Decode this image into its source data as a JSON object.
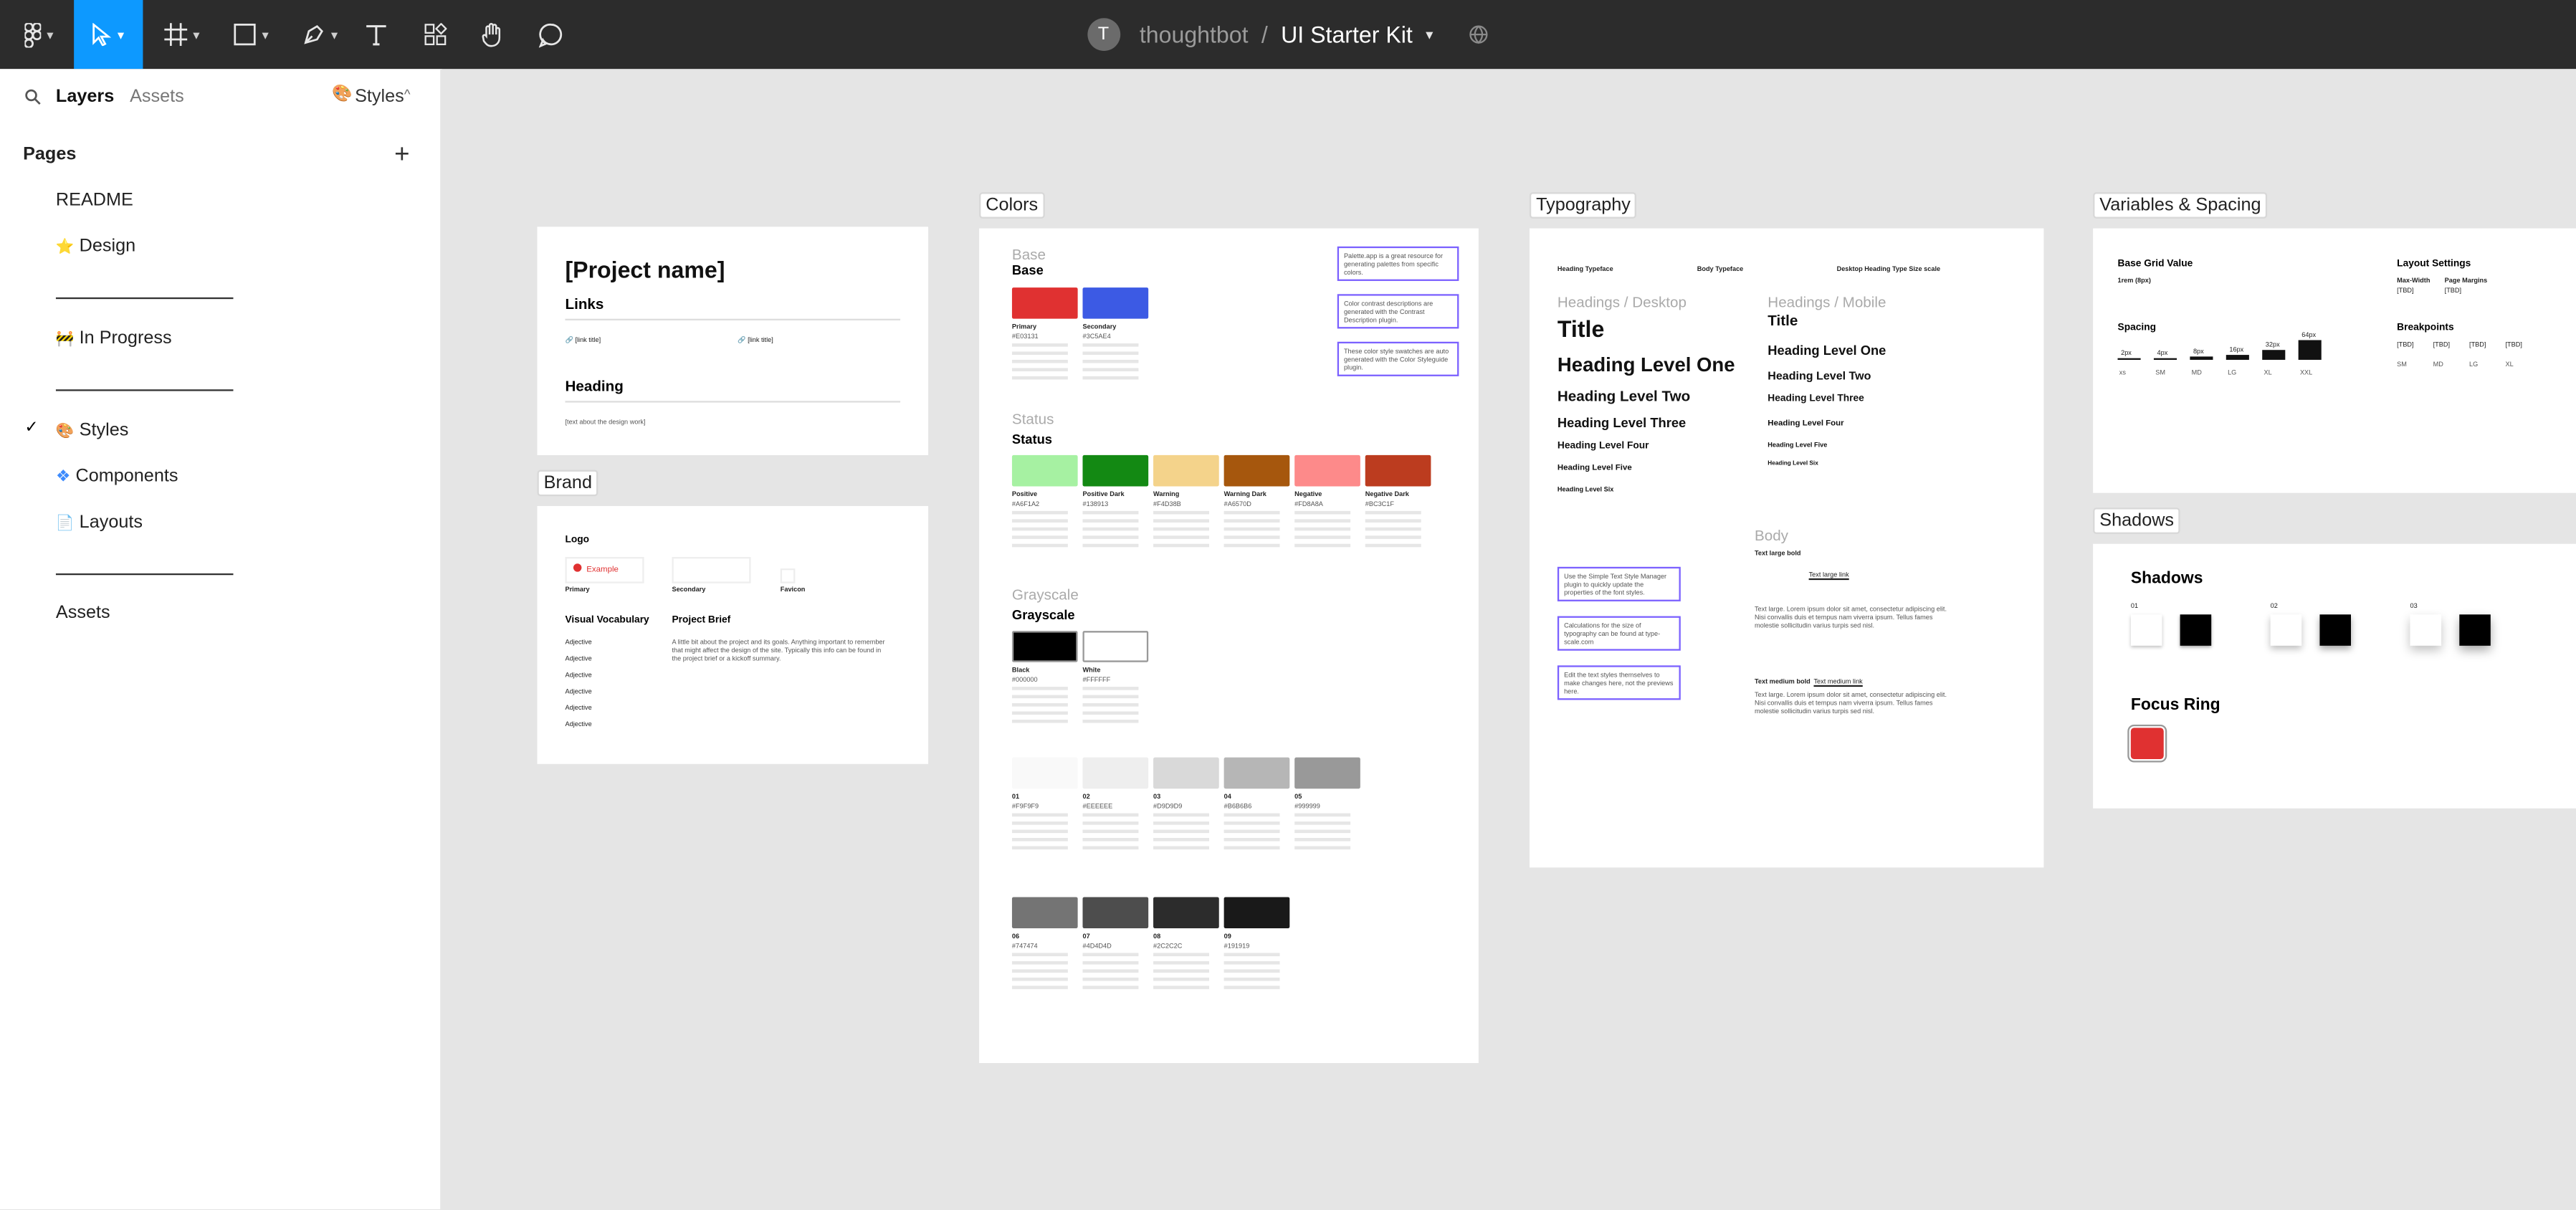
{
  "toolbar": {
    "project_owner": "thoughtbot",
    "separator": "/",
    "file_name": "UI Starter Kit",
    "avatar_letter": "T",
    "active_color": "#0d99ff"
  },
  "sidebar": {
    "tabs": {
      "layers": "Layers",
      "assets": "Assets",
      "styles": "Styles"
    },
    "pages_heading": "Pages",
    "pages": [
      {
        "label": "README",
        "icon": ""
      },
      {
        "label": "Design",
        "icon": "star-icon"
      },
      {
        "label": "In Progress",
        "icon": "construction-icon"
      },
      {
        "label": "Styles",
        "icon": "palette-icon",
        "selected": true
      },
      {
        "label": "Components",
        "icon": "components-icon"
      },
      {
        "label": "Layouts",
        "icon": "document-icon"
      },
      {
        "label": "Assets",
        "icon": ""
      }
    ]
  },
  "canvas": {
    "readme": {
      "title": "[Project name]",
      "links_h": "Links",
      "link1": "[link title]",
      "link2": "[link title]",
      "heading": "Heading",
      "body": "[text about the design work]"
    },
    "brand": {
      "label": "Brand",
      "logo_h": "Logo",
      "example": "Example",
      "primary": "Primary",
      "secondary": "Secondary",
      "favicon": "Favicon",
      "vv_h": "Visual Vocabulary",
      "adjectives": [
        "Adjective",
        "Adjective",
        "Adjective",
        "Adjective",
        "Adjective",
        "Adjective"
      ],
      "brief_h": "Project Brief",
      "brief_text": "A little bit about the project and its goals. Anything important to remember that might affect the design of the site. Typically this info can be found in the project brief or a kickoff summary."
    },
    "colors": {
      "label": "Colors",
      "base_h": "Base",
      "base": [
        {
          "name": "Primary",
          "hex": "#E03131",
          "color": "#e03131"
        },
        {
          "name": "Secondary",
          "hex": "#3C5AE4",
          "color": "#3c5ae4"
        }
      ],
      "status_h": "Status",
      "status": [
        {
          "name": "Positive",
          "hex": "#A6F1A2",
          "color": "#a6f1a2"
        },
        {
          "name": "Positive Dark",
          "hex": "#138913",
          "color": "#138913"
        },
        {
          "name": "Warning",
          "hex": "#F4D38B",
          "color": "#f4d38b"
        },
        {
          "name": "Warning Dark",
          "hex": "#A6570D",
          "color": "#a6570d"
        },
        {
          "name": "Negative",
          "hex": "#FD8A8A",
          "color": "#fd8a8a"
        },
        {
          "name": "Negative Dark",
          "hex": "#BC3C1F",
          "color": "#bc3c1f"
        }
      ],
      "grayscale_h": "Grayscale",
      "bw": [
        {
          "name": "Black",
          "hex": "#000000",
          "color": "#000000"
        },
        {
          "name": "White",
          "hex": "#FFFFFF",
          "color": "#ffffff"
        }
      ],
      "grays1": [
        {
          "name": "01",
          "hex": "#F9F9F9",
          "color": "#f9f9f9"
        },
        {
          "name": "02",
          "hex": "#EEEEEE",
          "color": "#eeeeee"
        },
        {
          "name": "03",
          "hex": "#D9D9D9",
          "color": "#d9d9d9"
        },
        {
          "name": "04",
          "hex": "#B6B6B6",
          "color": "#b6b6b6"
        },
        {
          "name": "05",
          "hex": "#999999",
          "color": "#999999"
        }
      ],
      "grays2": [
        {
          "name": "06",
          "hex": "#747474",
          "color": "#747474"
        },
        {
          "name": "07",
          "hex": "#4D4D4D",
          "color": "#4d4d4d"
        },
        {
          "name": "08",
          "hex": "#2C2C2C",
          "color": "#2c2c2c"
        },
        {
          "name": "09",
          "hex": "#191919",
          "color": "#191919"
        }
      ],
      "notes": [
        "Palette.app is a great resource for generating palettes from specific colors.",
        "Color contrast descriptions are generated with the Contrast Description plugin.",
        "These color style swatches are auto generated with the Color Styleguide plugin."
      ]
    },
    "typography": {
      "label": "Typography",
      "heading_typeface": "Heading Typeface",
      "body_typeface": "Body Typeface",
      "scale": "Desktop Heading Type Size scale",
      "desktop_h": "Headings / Desktop",
      "mobile_h": "Headings / Mobile",
      "desktop": [
        "Title",
        "Heading Level One",
        "Heading Level Two",
        "Heading Level Three",
        "Heading Level Four",
        "Heading Level Five",
        "Heading Level Six"
      ],
      "mobile": [
        "Title",
        "Heading Level One",
        "Heading Level Two",
        "Heading Level Three",
        "Heading Level Four",
        "Heading Level Five",
        "Heading Level Six"
      ],
      "body_h": "Body",
      "notes": [
        "Use the Simple Text Style Manager plugin to quickly update the properties of the font styles.",
        "Calculations for the size of typography can be found at type-scale.com",
        "Edit the text styles themselves to make changes here, not the previews here."
      ],
      "text_large_bold": "Text large bold",
      "text_large_link": "Text large link",
      "lorem": "Text large. Lorem ipsum dolor sit amet, consectetur adipiscing elit. Nisi convallis duis et tempus nam viverra ipsum. Tellus fames molestie sollicitudin varius turpis sed nisl.",
      "text_medium_bold": "Text medium bold",
      "text_medium_link": "Text medium link"
    },
    "variables": {
      "label": "Variables & Spacing",
      "grid_h": "Base Grid Value",
      "grid_v": "1rem (8px)",
      "layout_h": "Layout Settings",
      "max_width": "Max-Width",
      "page_margins": "Page Margins",
      "tbd": "[TBD]",
      "spacing_h": "Spacing",
      "spacing": [
        "2px",
        "4px",
        "8px",
        "16px",
        "32px",
        "64px"
      ],
      "spacing_names": [
        "xs",
        "SM",
        "MD",
        "LG",
        "XL",
        "XXL"
      ],
      "breakpoints_h": "Breakpoints",
      "bp_names": [
        "SM",
        "MD",
        "LG",
        "XL"
      ]
    },
    "shadows": {
      "label": "Shadows",
      "heading": "Shadows",
      "levels": [
        "01",
        "02",
        "03"
      ],
      "focus_h": "Focus Ring",
      "focus_color": "#e03131"
    }
  }
}
